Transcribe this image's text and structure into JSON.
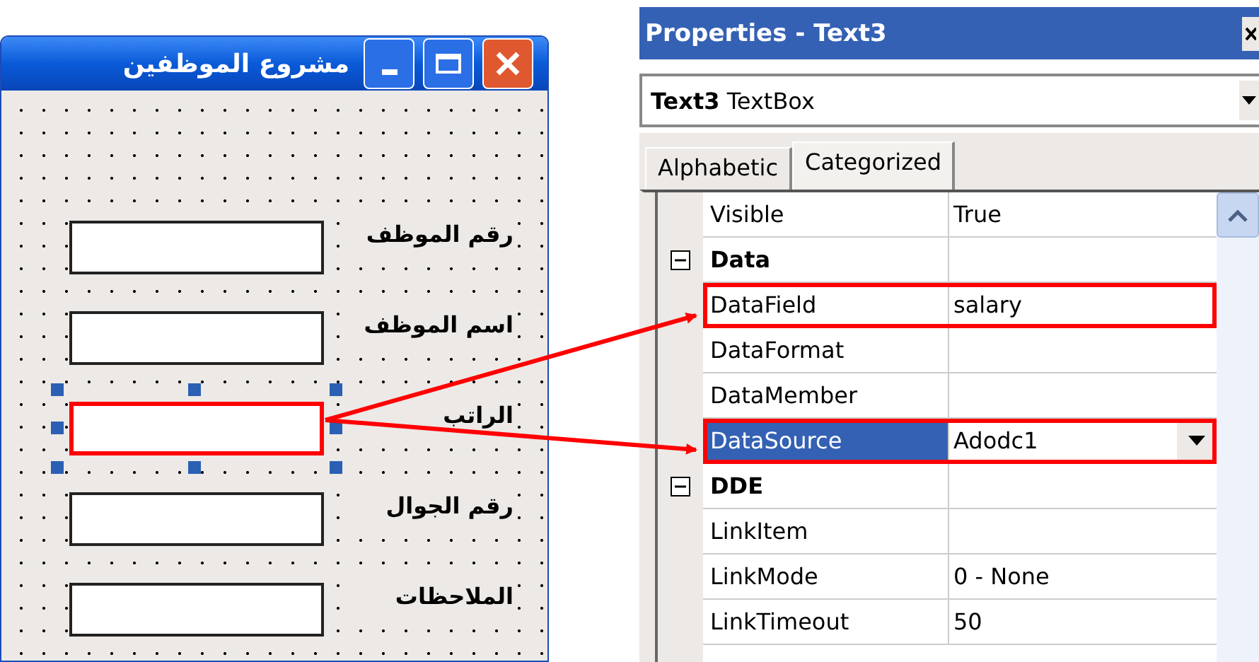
{
  "form_window": {
    "title": "مشروع الموظفين",
    "fields": [
      {
        "label": "رقم الموظف",
        "selected": false
      },
      {
        "label": "اسم الموظف",
        "selected": false
      },
      {
        "label": "الراتب",
        "selected": true
      },
      {
        "label": "رقم الجوال",
        "selected": false
      },
      {
        "label": "الملاحظات",
        "selected": false
      }
    ]
  },
  "properties_window": {
    "title": "Properties - Text3",
    "object_selector": "**Text3** TextBox",
    "tabs": [
      {
        "label": "Alphabetic",
        "selected": false
      },
      {
        "label": "Categorized",
        "selected": true
      }
    ],
    "rows": [
      {
        "kind": "property",
        "name": "Visible",
        "value": "True",
        "selected": false,
        "highlighted": false
      },
      {
        "kind": "category",
        "name": "Data",
        "expanded": true
      },
      {
        "kind": "property",
        "name": "DataField",
        "value": "salary",
        "selected": false,
        "highlighted": true
      },
      {
        "kind": "property",
        "name": "DataFormat",
        "value": "",
        "selected": false,
        "highlighted": false
      },
      {
        "kind": "property",
        "name": "DataMember",
        "value": "",
        "selected": false,
        "highlighted": false
      },
      {
        "kind": "property",
        "name": "DataSource",
        "value": "Adodc1",
        "selected": true,
        "highlighted": true
      },
      {
        "kind": "category",
        "name": "DDE",
        "expanded": true
      },
      {
        "kind": "property",
        "name": "LinkItem",
        "value": "",
        "selected": false,
        "highlighted": false
      },
      {
        "kind": "property",
        "name": "LinkMode",
        "value": "0 - None",
        "selected": false,
        "highlighted": false
      },
      {
        "kind": "property",
        "name": "LinkTimeout",
        "value": "50",
        "selected": false,
        "highlighted": false
      }
    ]
  }
}
